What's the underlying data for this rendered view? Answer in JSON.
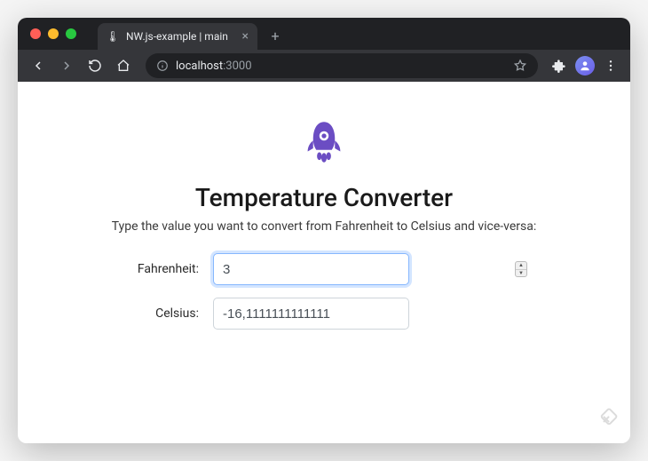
{
  "browser": {
    "tab": {
      "favicon": "🌡",
      "title": "NW.js-example | main"
    },
    "url": {
      "host": "localhost",
      "port": ":3000"
    }
  },
  "page": {
    "title": "Temperature Converter",
    "subtitle": "Type the value you want to convert from Fahrenheit to Celsius and vice-versa:",
    "fields": {
      "fahrenheit": {
        "label": "Fahrenheit:",
        "value": "3"
      },
      "celsius": {
        "label": "Celsius:",
        "value": "-16,1111111111111"
      }
    }
  },
  "colors": {
    "accent": "#6b4dc3",
    "focus_ring": "#86b7fe"
  }
}
